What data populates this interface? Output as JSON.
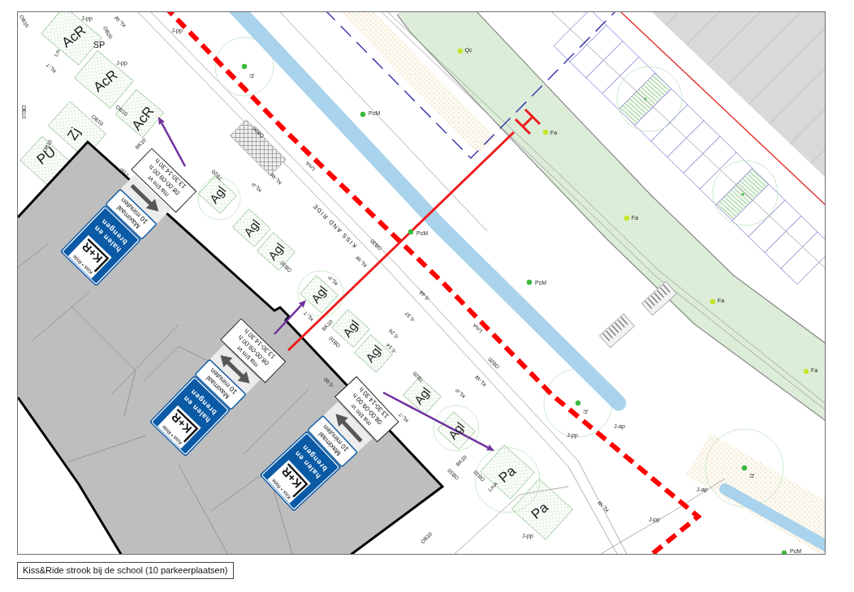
{
  "map": {
    "bed_codes": [
      "AcR",
      "AcR",
      "AcR",
      "Zj",
      "PU",
      "Agl",
      "Agl",
      "Agl",
      "Agl",
      "Agl",
      "Agl",
      "Agl",
      "Agl",
      "Pa",
      "Pa"
    ],
    "trees": [
      {
        "code": "Qc",
        "color": "#c6e42c"
      },
      {
        "code": "PcM",
        "color": "#3cb93c"
      },
      {
        "code": "PcM",
        "color": "#3cb93c"
      },
      {
        "code": "PcM",
        "color": "#3cb93c"
      },
      {
        "code": "PcM",
        "color": "#3cb93c"
      },
      {
        "code": "Fa",
        "color": "#c6e42c"
      },
      {
        "code": "Fa",
        "color": "#c6e42c"
      },
      {
        "code": "Fa",
        "color": "#c6e42c"
      },
      {
        "code": "Fa",
        "color": "#c6e42c"
      },
      {
        "code": "Tl",
        "color": "#3cb93c"
      },
      {
        "code": "Tl",
        "color": "#3cb93c"
      },
      {
        "code": "Tl",
        "color": "#3cb93c"
      }
    ],
    "plan_codes": [
      "J-pp",
      "J-pp",
      "J-pp",
      "SP",
      "OB20",
      "KL-W",
      "KL-T",
      "Lm",
      "OB10",
      "OB10",
      "OB10",
      "OB10",
      "BK10",
      "OB10",
      "OB20",
      "1.00",
      "TB20",
      "KL-P",
      "KL-W",
      "LmA",
      "OB20",
      "KL-W",
      "OB10",
      "KL-P",
      "KL-T",
      "BK10",
      "OB10",
      "-5.48",
      "-5.37",
      "-5.26",
      "-5.14",
      "-5.00",
      "TB20",
      "KL-P",
      "KL-W",
      "OB20",
      "LmA",
      "KL-T",
      "BK10",
      "OB10",
      "OB10",
      "LmA",
      "OB10",
      "J-pp",
      "J-pp",
      "J-ap",
      "J-ap",
      "J-pp",
      "KL-W"
    ],
    "road_marking": "KISS AND RIDE",
    "signs": [
      {
        "kind": "left",
        "logo": "K+R",
        "logo_caption": "Kiss • Ride",
        "text": [
          "halen en",
          "brengen"
        ],
        "limit": [
          "Maximaal",
          "10 minuten"
        ],
        "schedule": [
          "ma t/m vr",
          "08.00-09.00 h",
          "13.30-14.30 h"
        ]
      },
      {
        "kind": "both",
        "logo": "K+R",
        "logo_caption": "Kiss • Ride",
        "text": [
          "halen en",
          "brengen"
        ],
        "limit": [
          "Maximaal",
          "10 minuten"
        ],
        "schedule": [
          "ma t/m vr",
          "08.00-09.00 h",
          "13.30-14.30 h"
        ]
      },
      {
        "kind": "right",
        "logo": "K+R",
        "logo_caption": "Kiss • Ride",
        "text": [
          "halen en",
          "brengen"
        ],
        "limit": [
          "Maximaal",
          "10 minuten"
        ],
        "schedule": [
          "ma t/m vr",
          "08.00-09.00 h",
          "13.30-14.30 h"
        ]
      }
    ]
  },
  "caption": "Kiss&Ride strook bij de school (10 parkeerplaatsen)"
}
